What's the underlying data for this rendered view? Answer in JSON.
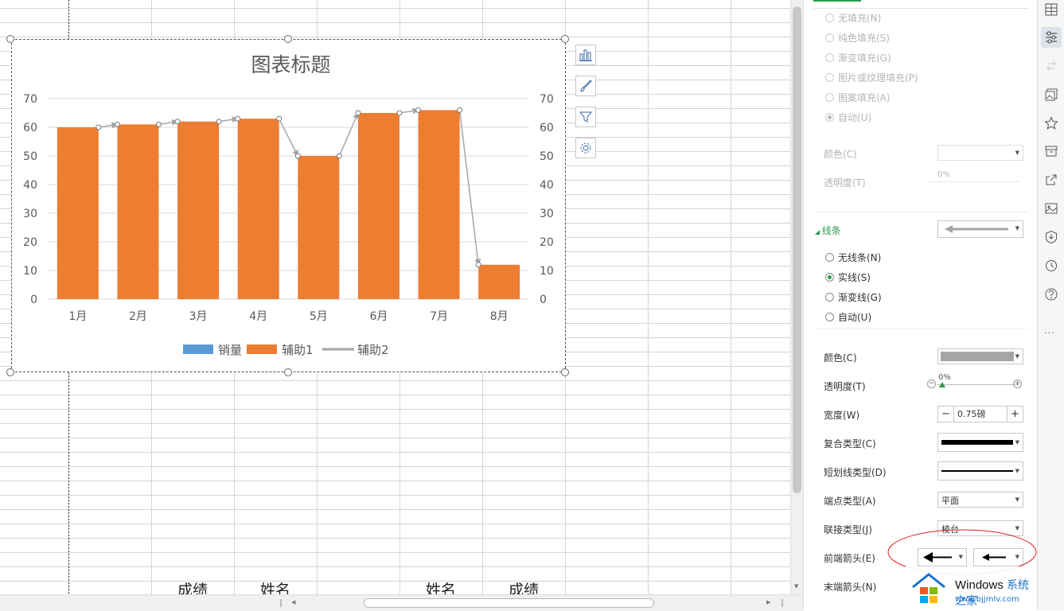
{
  "sheet": {
    "bottom_cells": [
      "成绩",
      "姓名",
      "姓名",
      "成绩"
    ]
  },
  "chart_data": {
    "type": "bar",
    "title": "图表标题",
    "categories": [
      "1月",
      "2月",
      "3月",
      "4月",
      "5月",
      "6月",
      "7月",
      "8月"
    ],
    "series": [
      {
        "name": "销量",
        "values": [],
        "color": "#5b9bd5"
      },
      {
        "name": "辅助1",
        "values": [
          60,
          61,
          62,
          63,
          50,
          65,
          66,
          12
        ],
        "color": "#ed7d31"
      },
      {
        "name": "辅助2",
        "type": "line-arrows",
        "values": [
          61,
          62,
          63,
          50,
          65,
          66,
          12
        ],
        "color": "#a5a5a5"
      }
    ],
    "ylim": [
      0,
      70
    ],
    "yticks": [
      0,
      10,
      20,
      30,
      40,
      50,
      60,
      70
    ],
    "secondary_yticks": [
      0,
      10,
      20,
      30,
      40,
      50,
      60,
      70
    ],
    "grid": true,
    "legend_position": "bottom"
  },
  "chart_tools": [
    "chart-elements-icon",
    "chart-style-icon",
    "chart-filter-icon",
    "chart-settings-icon"
  ],
  "panel": {
    "fill_options": [
      {
        "label": "无填充(N)",
        "checked": false
      },
      {
        "label": "纯色填充(S)",
        "checked": false
      },
      {
        "label": "渐变填充(G)",
        "checked": false
      },
      {
        "label": "图片或纹理填充(P)",
        "checked": false
      },
      {
        "label": "图案填充(A)",
        "checked": false
      },
      {
        "label": "自动(U)",
        "checked": true
      }
    ],
    "fill_color_label": "颜色(C)",
    "fill_transparency_label": "透明度(T)",
    "fill_transparency_value": "0%",
    "line_section_title": "线条",
    "line_options": [
      {
        "label": "无线条(N)",
        "checked": false
      },
      {
        "label": "实线(S)",
        "checked": true
      },
      {
        "label": "渐变线(G)",
        "checked": false
      },
      {
        "label": "自动(U)",
        "checked": false
      }
    ],
    "color_label": "颜色(C)",
    "transparency_label": "透明度(T)",
    "transparency_value": "0%",
    "width_label": "宽度(W)",
    "width_value": "0.75磅",
    "compound_label": "复合类型(C)",
    "dash_label": "短划线类型(D)",
    "cap_label": "端点类型(A)",
    "cap_value": "平面",
    "join_label": "联接类型(J)",
    "join_value": "棱台",
    "begin_arrow_label": "前端箭头(E)",
    "end_arrow_label": "末端箭头(N)",
    "line_color": "#a5a5a5",
    "accent": "#2e9a4b"
  },
  "watermark": {
    "brand": "Windows",
    "brand_suffix": "系统之家",
    "url": "www.bjjmlv.com"
  }
}
